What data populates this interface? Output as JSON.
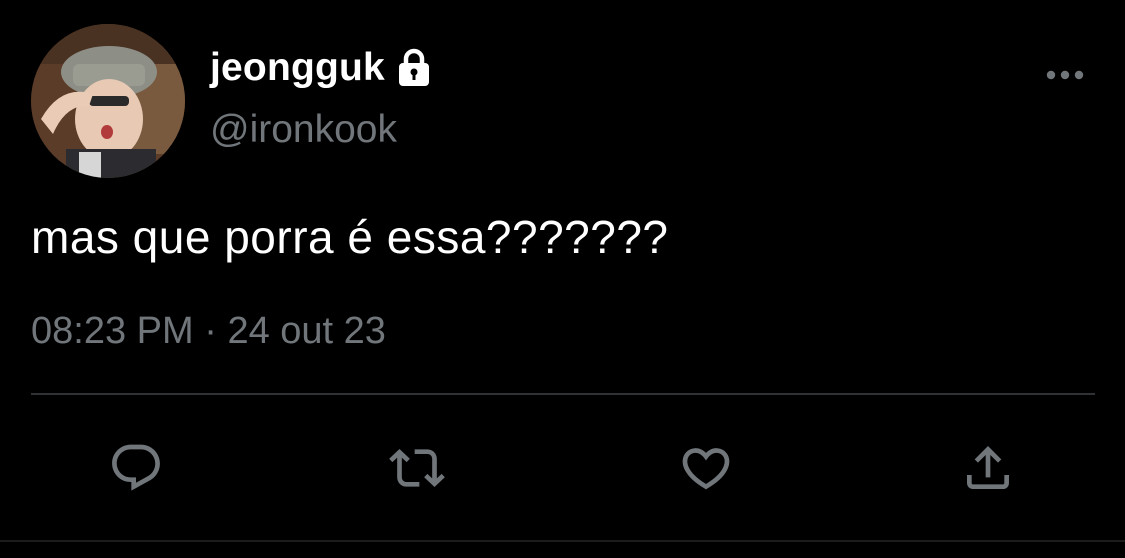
{
  "user": {
    "display_name": "jeongguk",
    "handle": "@ironkook",
    "protected_icon": "lock-icon",
    "avatar_icon": "profile-photo"
  },
  "tweet": {
    "text": "mas que porra é essa???????",
    "time": "08:23 PM",
    "separator": " · ",
    "date": "24 out 23"
  },
  "actions": [
    {
      "name": "reply",
      "icon": "reply-icon"
    },
    {
      "name": "retweet",
      "icon": "retweet-icon"
    },
    {
      "name": "like",
      "icon": "heart-icon"
    },
    {
      "name": "share",
      "icon": "share-icon"
    }
  ],
  "colors": {
    "background": "#000000",
    "primary_text": "#ffffff",
    "secondary_text": "#71767b",
    "divider": "#2f3336"
  }
}
